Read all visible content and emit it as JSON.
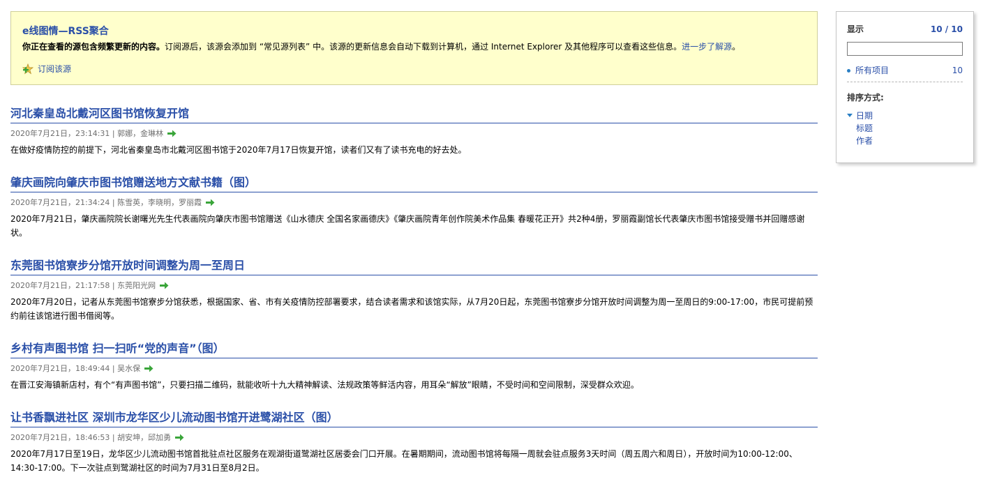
{
  "banner": {
    "title": "e线图情—RSS聚合",
    "desc_bold": "你正在查看的源包含频繁更新的内容。",
    "desc_text": "订阅源后，该源会添加到 “常见源列表” 中。该源的更新信息会自动下载到计算机，通过 Internet Explorer 及其他程序可以查看这些信息。",
    "learn_more": "进一步了解源",
    "desc_end": "。",
    "subscribe_label": "订阅该源"
  },
  "items": [
    {
      "title": "河北秦皇岛北戴河区图书馆恢复开馆",
      "meta": "2020年7月21日，23:14:31 | 郭娜，金琳林",
      "body": "在做好疫情防控的前提下，河北省秦皇岛市北戴河区图书馆于2020年7月17日恢复开馆，读者们又有了读书充电的好去处。"
    },
    {
      "title": "肇庆画院向肇庆市图书馆赠送地方文献书籍（图）",
      "meta": "2020年7月21日，21:34:24 | 陈雪英，李晓明，罗丽霞",
      "body": "2020年7月21日，肇庆画院院长谢曙光先生代表画院向肇庆市图书馆赠送《山水德庆 全国名家画德庆》《肇庆画院青年创作院美术作品集 春暖花正开》共2种4册，罗丽霞副馆长代表肇庆市图书馆接受赠书并回赠感谢状。"
    },
    {
      "title": "东莞图书馆寮步分馆开放时间调整为周一至周日",
      "meta": "2020年7月21日，21:17:58 | 东莞阳光网",
      "body": "2020年7月20日，记者从东莞图书馆寮步分馆获悉，根据国家、省、市有关疫情防控部署要求，结合读者需求和该馆实际，从7月20日起，东莞图书馆寮步分馆开放时间调整为周一至周日的9:00-17:00，市民可提前预约前往该馆进行图书借阅等。"
    },
    {
      "title": "乡村有声图书馆 扫一扫听“党的声音”（图）",
      "meta": "2020年7月21日，18:49:44 | 吴水保",
      "body": "在晋江安海镇新店村，有个“有声图书馆”，只要扫描二维码，就能收听十九大精神解读、法规政策等鲜活内容，用耳朵“解放”眼睛，不受时间和空间限制，深受群众欢迎。"
    },
    {
      "title": "让书香飘进社区 深圳市龙华区少儿流动图书馆开进鹭湖社区（图）",
      "meta": "2020年7月21日，18:46:53 | 胡安坤，邱加勇",
      "body": "2020年7月17日至19日，龙华区少儿流动图书馆首批驻点社区服务在观湖街道鹭湖社区居委会门口开展。在暑期期间，流动图书馆将每隔一周就会驻点服务3天时间（周五周六和周日），开放时间为10:00-12:00、14:30-17:00。下一次驻点到鹭湖社区的时间为7月31日至8月2日。"
    }
  ],
  "sidebar": {
    "display_label": "显示",
    "display_count": "10 / 10",
    "search_value": "",
    "all_items_label": "所有项目",
    "all_items_count": "10",
    "sort_label": "排序方式:",
    "sort_options": [
      "日期",
      "标题",
      "作者"
    ]
  },
  "colors": {
    "link": "#2a4fa8",
    "banner_bg": "#ffffcc",
    "arrow": "#3aa53a"
  },
  "icons": {
    "subscribe": "plus-star-icon",
    "meta_arrow": "green-arrow-icon",
    "sort_indicator": "triangle-down-icon"
  }
}
